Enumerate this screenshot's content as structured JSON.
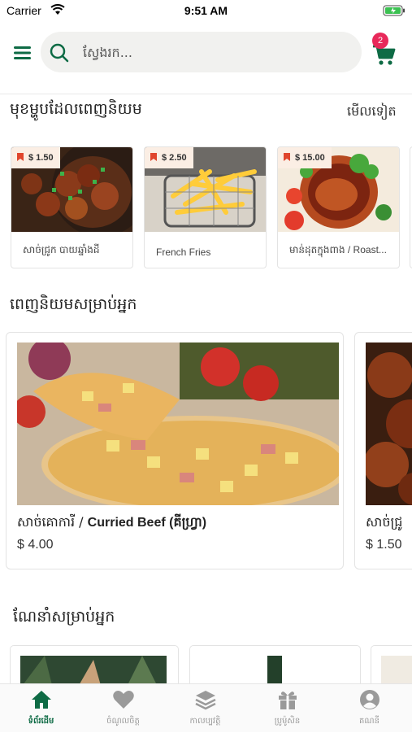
{
  "status": {
    "carrier": "Carrier",
    "time": "9:51 AM"
  },
  "header": {
    "search_placeholder": "ស្វែងរក...",
    "cart_count": "2",
    "brand_color": "#0e6b45"
  },
  "popular": {
    "title": "មុខម្ហូបដែលពេញនិយម",
    "see_more": "មើលទៀត",
    "items": [
      {
        "price": "$ 1.50",
        "name": "សាច់ជ្រូក បាយឆ្នាំងដី"
      },
      {
        "price": "$ 2.50",
        "name": "French Fries"
      },
      {
        "price": "$ 15.00",
        "name": "មាន់ដុតក្នុងពាង / Roast..."
      }
    ]
  },
  "recommended": {
    "title": "ពេញនិយមសម្រាប់អ្នក",
    "items": [
      {
        "name_km": "សាច់គោការី / ",
        "name_en": "Curried Beef",
        "name_suffix": " (គីហ្វ្រា)",
        "price": "$ 4.00"
      },
      {
        "name_km": "សាច់ជ្រូ",
        "name_en": "",
        "name_suffix": "",
        "price": "$ 1.50"
      }
    ]
  },
  "suggested": {
    "title": "ណែនាំសម្រាប់អ្នក"
  },
  "nav": [
    {
      "label": "ទំព័រដើម",
      "icon": "home-icon",
      "active": true
    },
    {
      "label": "ចំណូលចិត្ត",
      "icon": "heart-icon",
      "active": false
    },
    {
      "label": "កាលប្បវត្តិ",
      "icon": "layers-icon",
      "active": false
    },
    {
      "label": "ប្រូម៉ូសិន",
      "icon": "gift-icon",
      "active": false
    },
    {
      "label": "គណនី",
      "icon": "account-icon",
      "active": false
    }
  ]
}
